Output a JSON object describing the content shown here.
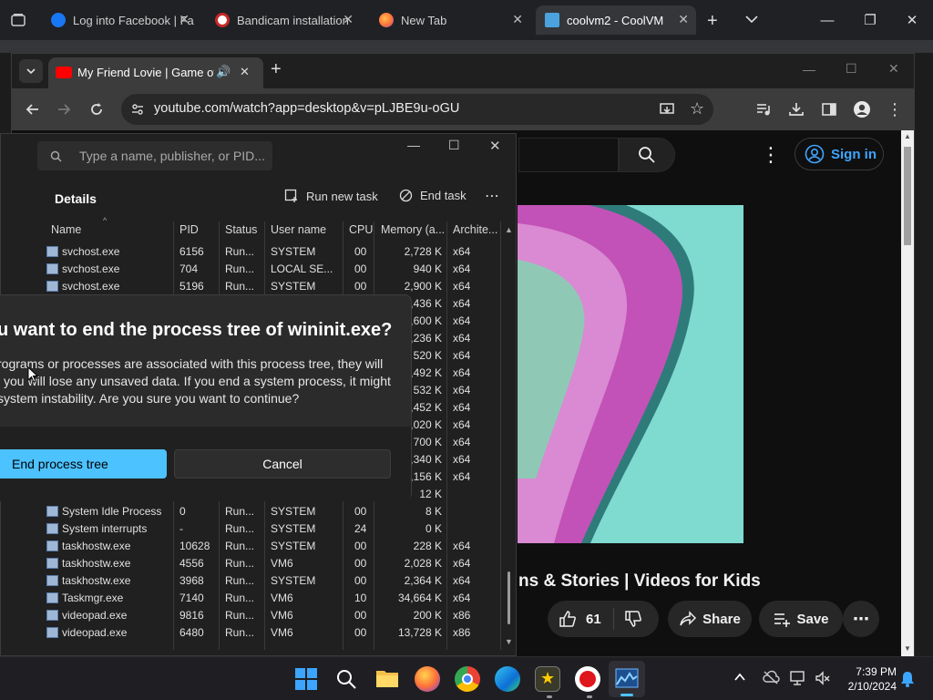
{
  "outer_tabs": [
    {
      "label": "Log into Facebook | Fa",
      "color": "#1877f2"
    },
    {
      "label": "Bandicam installation",
      "color": "#c62828"
    },
    {
      "label": "New Tab",
      "color": "#ff7139"
    },
    {
      "label": "coolvm2 - CoolVM",
      "color": "#4aa3df"
    }
  ],
  "inner_tab": {
    "label": "My Friend Lovie | Game of M"
  },
  "address": {
    "url": "youtube.com/watch?app=desktop&v=pLJBE9u-oGU"
  },
  "youtube": {
    "sign_in": "Sign in",
    "title": "ns & Stories | Videos for Kids",
    "likes": "61",
    "share": "Share",
    "save": "Save"
  },
  "taskmgr": {
    "search_placeholder": "Type a name, publisher, or PID...",
    "section": "Details",
    "run_new_task": "Run new task",
    "end_task": "End task",
    "columns": [
      "Name",
      "PID",
      "Status",
      "User name",
      "CPU",
      "Memory (a...",
      "Archite..."
    ],
    "rows": [
      {
        "name": "svchost.exe",
        "pid": "6156",
        "status": "Run...",
        "user": "SYSTEM",
        "cpu": "00",
        "mem": "2,728 K",
        "arch": "x64"
      },
      {
        "name": "svchost.exe",
        "pid": "704",
        "status": "Run...",
        "user": "LOCAL SE...",
        "cpu": "00",
        "mem": "940 K",
        "arch": "x64"
      },
      {
        "name": "svchost.exe",
        "pid": "5196",
        "status": "Run...",
        "user": "SYSTEM",
        "cpu": "00",
        "mem": "2,900 K",
        "arch": "x64"
      },
      {
        "name": "",
        "pid": "",
        "status": "",
        "user": "",
        "cpu": "",
        "mem": ",436 K",
        "arch": "x64"
      },
      {
        "name": "",
        "pid": "",
        "status": "",
        "user": "",
        "cpu": "",
        "mem": ",600 K",
        "arch": "x64"
      },
      {
        "name": "",
        "pid": "",
        "status": "",
        "user": "",
        "cpu": "",
        "mem": ",236 K",
        "arch": "x64"
      },
      {
        "name": "",
        "pid": "",
        "status": "",
        "user": "",
        "cpu": "",
        "mem": "520 K",
        "arch": "x64"
      },
      {
        "name": "",
        "pid": "",
        "status": "",
        "user": "",
        "cpu": "",
        "mem": ",492 K",
        "arch": "x64"
      },
      {
        "name": "",
        "pid": "",
        "status": "",
        "user": "",
        "cpu": "",
        "mem": "532 K",
        "arch": "x64"
      },
      {
        "name": "",
        "pid": "",
        "status": "",
        "user": "",
        "cpu": "",
        "mem": ",452 K",
        "arch": "x64"
      },
      {
        "name": "",
        "pid": "",
        "status": "",
        "user": "",
        "cpu": "",
        "mem": ",020 K",
        "arch": "x64"
      },
      {
        "name": "",
        "pid": "",
        "status": "",
        "user": "",
        "cpu": "",
        "mem": "700 K",
        "arch": "x64"
      },
      {
        "name": "",
        "pid": "",
        "status": "",
        "user": "",
        "cpu": "",
        "mem": ",340 K",
        "arch": "x64"
      },
      {
        "name": "",
        "pid": "",
        "status": "",
        "user": "",
        "cpu": "",
        "mem": ",156 K",
        "arch": "x64"
      },
      {
        "name": "",
        "pid": "",
        "status": "",
        "user": "",
        "cpu": "",
        "mem": "12 K",
        "arch": ""
      },
      {
        "name": "System Idle Process",
        "pid": "0",
        "status": "Run...",
        "user": "SYSTEM",
        "cpu": "00",
        "mem": "8 K",
        "arch": ""
      },
      {
        "name": "System interrupts",
        "pid": "-",
        "status": "Run...",
        "user": "SYSTEM",
        "cpu": "24",
        "mem": "0 K",
        "arch": ""
      },
      {
        "name": "taskhostw.exe",
        "pid": "10628",
        "status": "Run...",
        "user": "SYSTEM",
        "cpu": "00",
        "mem": "228 K",
        "arch": "x64"
      },
      {
        "name": "taskhostw.exe",
        "pid": "4556",
        "status": "Run...",
        "user": "VM6",
        "cpu": "00",
        "mem": "2,028 K",
        "arch": "x64"
      },
      {
        "name": "taskhostw.exe",
        "pid": "3968",
        "status": "Run...",
        "user": "SYSTEM",
        "cpu": "00",
        "mem": "2,364 K",
        "arch": "x64"
      },
      {
        "name": "Taskmgr.exe",
        "pid": "7140",
        "status": "Run...",
        "user": "VM6",
        "cpu": "10",
        "mem": "34,664 K",
        "arch": "x64"
      },
      {
        "name": "videopad.exe",
        "pid": "9816",
        "status": "Run...",
        "user": "VM6",
        "cpu": "00",
        "mem": "200 K",
        "arch": "x86"
      },
      {
        "name": "videopad.exe",
        "pid": "6480",
        "status": "Run...",
        "user": "VM6",
        "cpu": "00",
        "mem": "13,728 K",
        "arch": "x86"
      }
    ]
  },
  "dialog": {
    "title": "u want to end the process tree of wininit.exe?",
    "body_1": "rograms or processes are associated with this process tree, they will",
    "body_2": "l you will lose any unsaved data. If you end a system process, it might",
    "body_3": "system instability. Are you sure you want to continue?",
    "primary": "End process tree",
    "secondary": "Cancel"
  },
  "taskbar": {
    "time": "7:39 PM",
    "date": "2/10/2024"
  }
}
